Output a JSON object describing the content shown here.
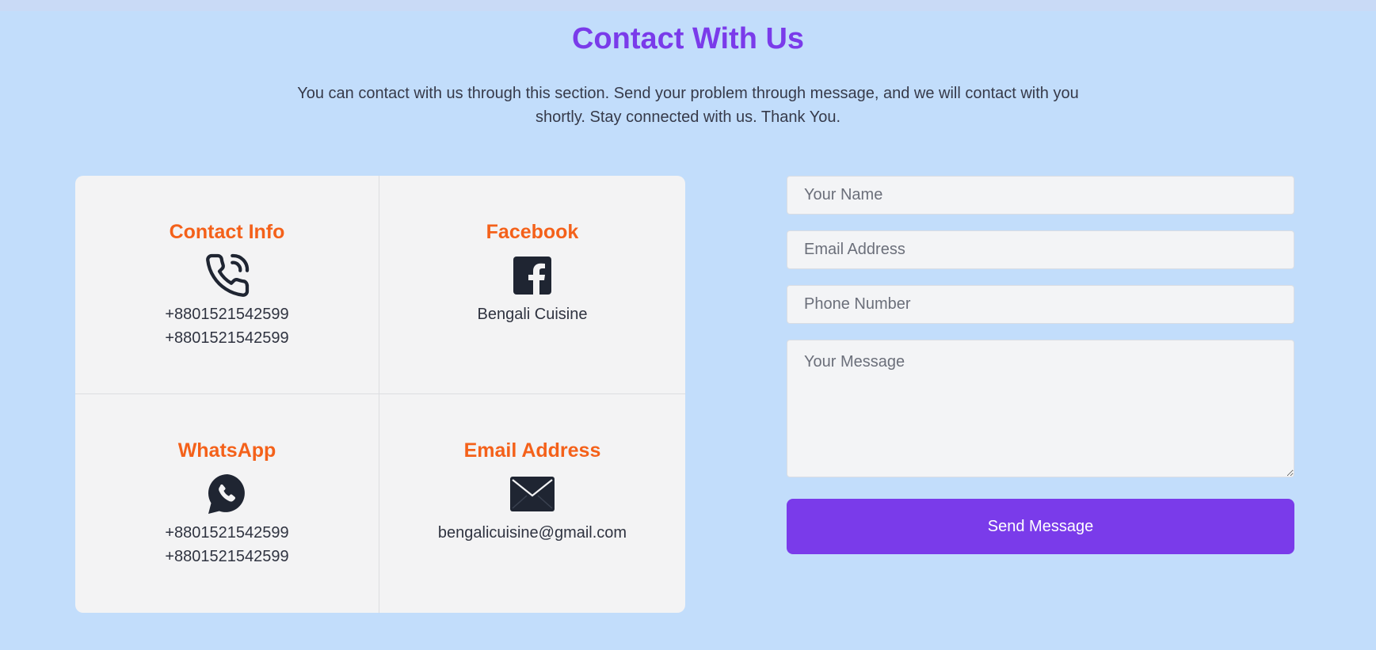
{
  "header": {
    "title": "Contact With Us",
    "description": "You can contact with us through this section. Send your problem through message, and we will contact with you shortly. Stay connected with us. Thank You."
  },
  "contact_cards": [
    {
      "title": "Contact Info",
      "icon": "phone-ringing-icon",
      "lines": [
        "+8801521542599",
        "+8801521542599"
      ]
    },
    {
      "title": "Facebook",
      "icon": "facebook-icon",
      "lines": [
        "Bengali Cuisine"
      ]
    },
    {
      "title": "WhatsApp",
      "icon": "whatsapp-icon",
      "lines": [
        "+8801521542599",
        "+8801521542599"
      ]
    },
    {
      "title": "Email Address",
      "icon": "envelope-icon",
      "lines": [
        "bengalicuisine@gmail.com"
      ]
    }
  ],
  "form": {
    "name_placeholder": "Your Name",
    "email_placeholder": "Email Address",
    "phone_placeholder": "Phone Number",
    "message_placeholder": "Your Message",
    "submit_label": "Send Message"
  },
  "colors": {
    "background": "#c2ddfb",
    "title": "#7a3bea",
    "card_title": "#f4611a",
    "panel": "#f3f3f4",
    "button": "#7a3bea",
    "icon": "#1f2532"
  }
}
